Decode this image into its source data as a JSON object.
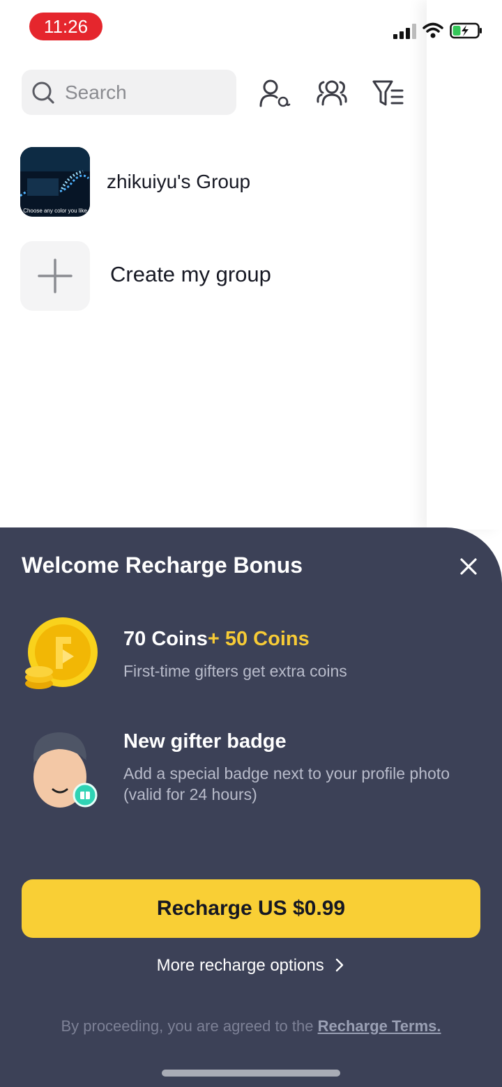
{
  "status_bar": {
    "time": "11:26"
  },
  "search": {
    "placeholder": "Search"
  },
  "top_icons": [
    "mention-contact-icon",
    "friends-icon",
    "filter-list-icon"
  ],
  "groups": [
    {
      "name": "zhikuiyu's Group",
      "thumbnail_caption": "Choose any color you like"
    }
  ],
  "create_group": {
    "label": "Create my group"
  },
  "sheet": {
    "title": "Welcome Recharge Bonus",
    "benefits": [
      {
        "icon": "coin-icon",
        "head": "70 Coins",
        "head_accent": "+ 50 Coins",
        "sub": "First-time gifters get extra coins"
      },
      {
        "icon": "gifter-avatar-icon",
        "head": "New gifter badge",
        "head_accent": "",
        "sub": "Add a special badge next to your profile photo (valid for 24 hours)"
      }
    ],
    "cta_label": "Recharge US $0.99",
    "more_label": "More recharge options",
    "terms_prefix": "By proceeding, you are agreed to the ",
    "terms_link": "Recharge Terms."
  },
  "colors": {
    "sheet_bg": "#3c4157",
    "cta": "#f9cf35",
    "accent": "#f7cb36",
    "status_time_bg": "#e5262d",
    "battery": "#34c759"
  }
}
